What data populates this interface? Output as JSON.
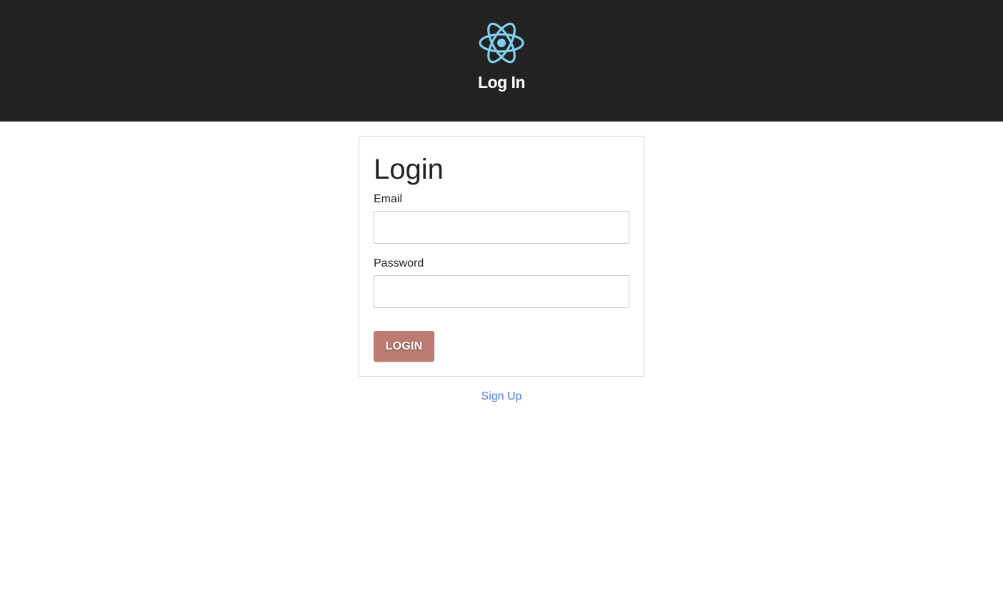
{
  "header": {
    "logo_icon": "react-atom-icon",
    "logo_color": "#7fd0f0",
    "title": "Log In",
    "background": "#222222"
  },
  "login_form": {
    "title": "Login",
    "email_label": "Email",
    "email_value": "",
    "password_label": "Password",
    "password_value": "",
    "submit_label": "LOGIN",
    "submit_color": "#bd7b72"
  },
  "footer": {
    "signup_label": "Sign Up",
    "link_color": "#4a7fd8"
  }
}
